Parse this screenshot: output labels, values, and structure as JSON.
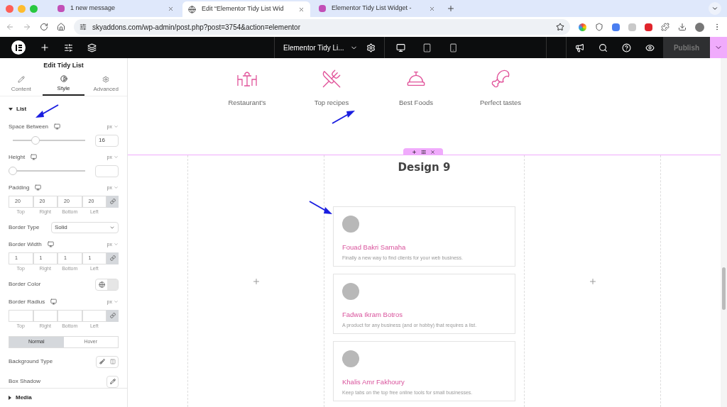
{
  "browser": {
    "tabs": [
      {
        "title": "1 new message",
        "selected": false
      },
      {
        "title": "Edit “Elementor Tidy List Wid",
        "selected": true
      },
      {
        "title": "Elementor Tidy List Widget -",
        "selected": false
      }
    ],
    "address": "skyaddons.com/wp-admin/post.php?post=3754&action=elementor"
  },
  "editor_bar": {
    "page_title": "Elementor Tidy Li...",
    "publish": "Publish"
  },
  "panel": {
    "title": "Edit Tidy List",
    "tabs": [
      {
        "label": "Content",
        "selected": false,
        "kind": "content"
      },
      {
        "label": "Style",
        "selected": true,
        "kind": "style"
      },
      {
        "label": "Advanced",
        "selected": false,
        "kind": "advanced"
      }
    ],
    "section": {
      "title": "List",
      "expanded": true
    },
    "controls": [
      {
        "kind": "slider",
        "label": "Space Between",
        "unit": "px",
        "value": "16",
        "level": 0.31
      },
      {
        "kind": "slider",
        "label": "Height",
        "unit": "px",
        "level": 0
      },
      {
        "kind": "dimensions",
        "label": "Padding",
        "unit": "px",
        "values": [
          "20",
          "20",
          "20",
          "20"
        ],
        "sublabels": [
          "Top",
          "Right",
          "Bottom",
          "Left"
        ],
        "linked": true
      },
      {
        "kind": "select",
        "label": "Border Type",
        "value": "Solid"
      },
      {
        "kind": "dimensions",
        "label": "Border Width",
        "unit": "px",
        "values": [
          "1",
          "1",
          "1",
          "1"
        ],
        "sublabels": [
          "Top",
          "Right",
          "Bottom",
          "Left"
        ],
        "linked": true
      },
      {
        "kind": "color",
        "label": "Border Color"
      },
      {
        "kind": "dimensions",
        "label": "Border Radius",
        "unit": "px",
        "sublabels": [
          "Top",
          "Right",
          "Bottom",
          "Left"
        ],
        "linked": true
      },
      {
        "kind": "states",
        "options": [
          {
            "label": "Normal",
            "selected": true
          },
          {
            "label": "Hover",
            "selected": false
          }
        ]
      },
      {
        "kind": "background",
        "label": "Background Type"
      },
      {
        "kind": "shadow",
        "label": "Box Shadow"
      }
    ],
    "collapsed_section": {
      "title": "Media",
      "expanded": false
    }
  },
  "canvas": {
    "icon_boxes": [
      {
        "label": "Restaurant's",
        "kind": "restaurant"
      },
      {
        "label": "Top recipes",
        "kind": "recipes"
      },
      {
        "label": "Best Foods",
        "kind": "foods"
      },
      {
        "label": "Perfect tastes",
        "kind": "tastes"
      }
    ],
    "heading": "Design 9",
    "list": [
      {
        "name": "Fouad Bakri Samaha",
        "description": "Finally a new way to find clients for your web business."
      },
      {
        "name": "Fadwa Ikram Botros",
        "description": "A product for any business (and or hobby) that requires a list."
      },
      {
        "name": "Khalis Amr Fakhoury",
        "description": "Keep tabs on the top free online tools for small businesses."
      }
    ]
  }
}
